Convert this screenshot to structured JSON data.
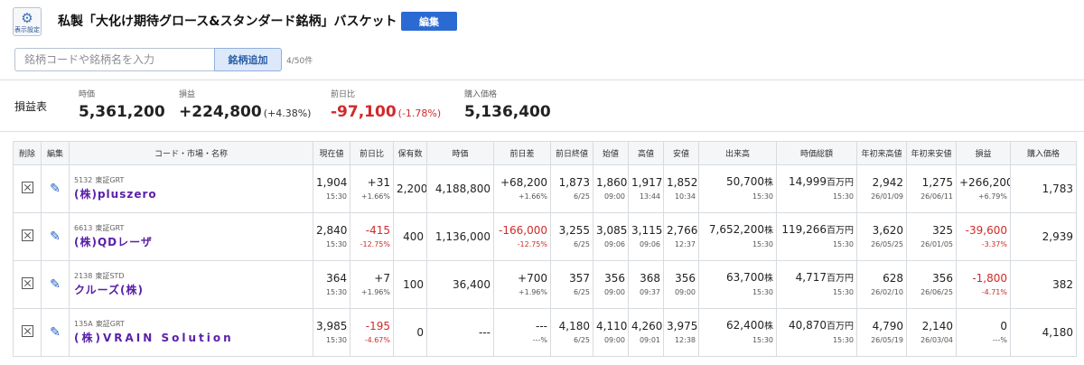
{
  "header": {
    "settings_label": "表示設定",
    "title": "私製「大化け期待グロース&スタンダード銘柄」バスケット",
    "edit_label": "編集",
    "search_placeholder": "銘柄コードや銘柄名を入力",
    "add_label": "銘柄追加",
    "count": "4/50件"
  },
  "summary": {
    "label": "損益表",
    "price": {
      "key": "時価",
      "value": "5,361,200"
    },
    "profit": {
      "key": "損益",
      "value": "+224,800",
      "sub": "(+4.38%)"
    },
    "change": {
      "key": "前日比",
      "value": "-97,100",
      "sub": "(-1.78%)"
    },
    "cost": {
      "key": "購入価格",
      "value": "5,136,400"
    }
  },
  "table": {
    "columns": [
      "削除",
      "編集",
      "コード・市場・名称",
      "現在値",
      "前日比",
      "保有数",
      "時価",
      "前日差",
      "前日終値",
      "始値",
      "高値",
      "安値",
      "出来高",
      "時価総額",
      "年初来高値",
      "年初来安値",
      "損益",
      "購入価格"
    ],
    "units": {
      "shares": "株",
      "million_yen": "百万円"
    },
    "rows": [
      {
        "code": "5132",
        "market": "東証GRT",
        "name": "(株)pluszero",
        "price": "1,904",
        "price_time": "15:30",
        "chg": "+31",
        "chg_pct": "+1.66%",
        "qty": "2,200",
        "value": "4,188,800",
        "diff": "+68,200",
        "diff_pct": "+1.66%",
        "prev": "1,873",
        "prev_date": "6/25",
        "open": "1,860",
        "open_time": "09:00",
        "high": "1,917",
        "high_time": "13:44",
        "low": "1,852",
        "low_time": "10:34",
        "vol": "50,700",
        "vol_time": "15:30",
        "cap": "14,999",
        "cap_time": "15:30",
        "yh": "2,942",
        "yh_date": "26/01/09",
        "yl": "1,275",
        "yl_date": "26/06/11",
        "pl": "+266,200",
        "pl_pct": "+6.79%",
        "cost": "1,783"
      },
      {
        "code": "6613",
        "market": "東証GRT",
        "name": "(株)QDレーザ",
        "price": "2,840",
        "price_time": "15:30",
        "chg": "-415",
        "chg_pct": "-12.75%",
        "qty": "400",
        "value": "1,136,000",
        "diff": "-166,000",
        "diff_pct": "-12.75%",
        "prev": "3,255",
        "prev_date": "6/25",
        "open": "3,085",
        "open_time": "09:06",
        "high": "3,115",
        "high_time": "09:06",
        "low": "2,766",
        "low_time": "12:37",
        "vol": "7,652,200",
        "vol_time": "15:30",
        "cap": "119,266",
        "cap_time": "15:30",
        "yh": "3,620",
        "yh_date": "26/05/25",
        "yl": "325",
        "yl_date": "26/01/05",
        "pl": "-39,600",
        "pl_pct": "-3.37%",
        "cost": "2,939"
      },
      {
        "code": "2138",
        "market": "東証STD",
        "name": "クルーズ(株)",
        "price": "364",
        "price_time": "15:30",
        "chg": "+7",
        "chg_pct": "+1.96%",
        "qty": "100",
        "value": "36,400",
        "diff": "+700",
        "diff_pct": "+1.96%",
        "prev": "357",
        "prev_date": "6/25",
        "open": "356",
        "open_time": "09:00",
        "high": "368",
        "high_time": "09:37",
        "low": "356",
        "low_time": "09:00",
        "vol": "63,700",
        "vol_time": "15:30",
        "cap": "4,717",
        "cap_time": "15:30",
        "yh": "628",
        "yh_date": "26/02/10",
        "yl": "356",
        "yl_date": "26/06/25",
        "pl": "-1,800",
        "pl_pct": "-4.71%",
        "cost": "382"
      },
      {
        "code": "135A",
        "market": "東証GRT",
        "name": "(株)VRAIN Solution",
        "price": "3,985",
        "price_time": "15:30",
        "chg": "-195",
        "chg_pct": "-4.67%",
        "qty": "0",
        "value": "---",
        "diff": "---",
        "diff_pct": "---%",
        "prev": "4,180",
        "prev_date": "6/25",
        "open": "4,110",
        "open_time": "09:00",
        "high": "4,260",
        "high_time": "09:01",
        "low": "3,975",
        "low_time": "12:38",
        "vol": "62,400",
        "vol_time": "15:30",
        "cap": "40,870",
        "cap_time": "15:30",
        "yh": "4,790",
        "yh_date": "26/05/19",
        "yl": "2,140",
        "yl_date": "26/03/04",
        "pl": "0",
        "pl_pct": "---%",
        "cost": "4,180"
      }
    ]
  },
  "colors": {
    "accent": "#2a6ad2",
    "negative": "#d12a2a",
    "name": "#5a21a8"
  }
}
